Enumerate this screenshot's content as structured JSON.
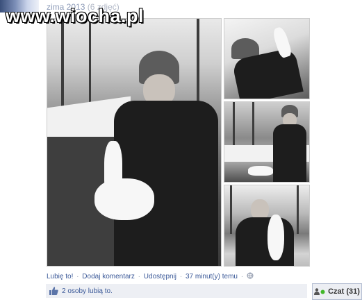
{
  "watermark": "www.wiocha.pl",
  "album": {
    "title": "zima 2013",
    "count": "(6 zdjęć)"
  },
  "actions": {
    "like": "Lubię to!",
    "comment": "Dodaj komentarz",
    "share": "Udostępnij",
    "time": "37 minut(y) temu",
    "separator": "·"
  },
  "likes": {
    "text": "2 osoby lubią to."
  },
  "chat": {
    "label": "Czat",
    "count": "(31)"
  },
  "icons": [
    "globe-icon",
    "thumbs-up-icon",
    "online-dot-icon",
    "person-icon"
  ],
  "colors": {
    "link": "#3b5998",
    "likes_bg": "#edeff4",
    "online": "#42b72a"
  }
}
